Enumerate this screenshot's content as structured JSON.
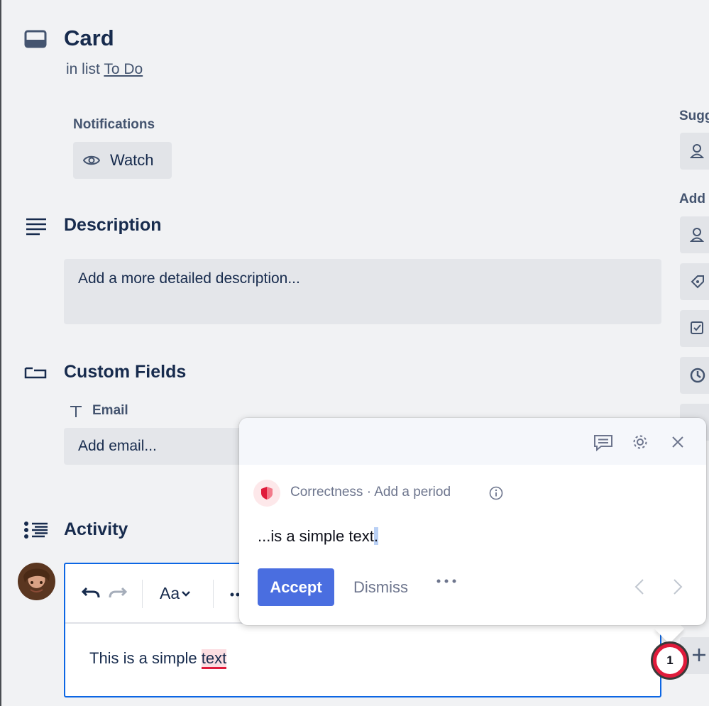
{
  "card": {
    "title": "Card",
    "list_prefix": "in list",
    "list_name": "To Do"
  },
  "notifications": {
    "label": "Notifications",
    "watch_label": "Watch"
  },
  "description": {
    "title": "Description",
    "placeholder": "Add a more detailed description..."
  },
  "custom_fields": {
    "title": "Custom Fields",
    "email_label": "Email",
    "email_placeholder": "Add email..."
  },
  "activity": {
    "title": "Activity",
    "editor": {
      "text_before": "This is a simple ",
      "flagged_word": "text",
      "format_label": "Aa"
    }
  },
  "sidebar": {
    "suggested_label": "Sugg",
    "add_label": "Add"
  },
  "grammar_popup": {
    "category": "Correctness · Add a period",
    "suggestion_text": "...is a simple text",
    "suggestion_insert": ".",
    "accept_label": "Accept",
    "dismiss_label": "Dismiss",
    "more_label": "···",
    "accent_color": "#4a6ee0",
    "alert_color": "#e01b3b"
  },
  "grammar_badge": {
    "count": "1"
  }
}
